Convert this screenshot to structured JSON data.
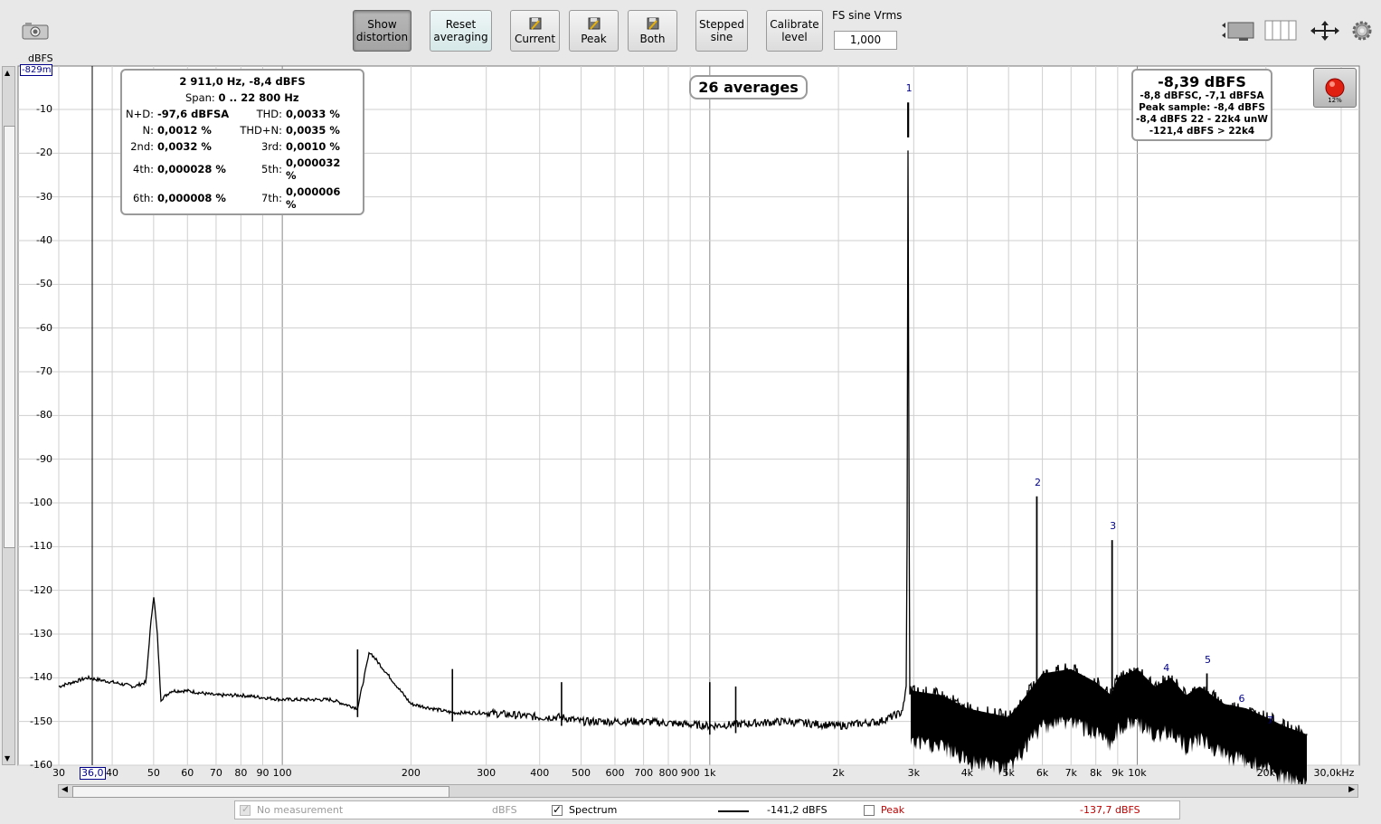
{
  "toolbar": {
    "show_distortion": "Show\ndistortion",
    "reset_averaging": "Reset\naveraging",
    "current": "Current",
    "peak": "Peak",
    "both": "Both",
    "stepped_sine": "Stepped\nsine",
    "calibrate_level": "Calibrate\nlevel",
    "fs_label": "FS sine Vrms",
    "fs_value": "1,000"
  },
  "y_axis": {
    "unit": "dBFS",
    "cursor_value": "-829m",
    "ticks": [
      "-10",
      "-20",
      "-30",
      "-40",
      "-50",
      "-60",
      "-70",
      "-80",
      "-90",
      "-100",
      "-110",
      "-120",
      "-130",
      "-140",
      "-150",
      "-160"
    ]
  },
  "x_axis": {
    "cursor_value": "36,0",
    "ticks": [
      "30",
      "40",
      "50",
      "60",
      "70",
      "80",
      "90",
      "100",
      "200",
      "300",
      "400",
      "500",
      "600",
      "700",
      "800",
      "900",
      "1k",
      "2k",
      "3k",
      "4k",
      "5k",
      "6k",
      "7k",
      "8k",
      "9k",
      "10k",
      "20k",
      "30,0kHz"
    ]
  },
  "distortion_panel": {
    "headline": "2 911,0 Hz, -8,4 dBFS",
    "span_label": "Span:",
    "span_value": "0 .. 22 800 Hz",
    "nd_label": "N+D:",
    "nd_value": "-97,6 dBFSA",
    "thd_label": "THD:",
    "thd_value": "0,0033 %",
    "n_label": "N:",
    "n_value": "0,0012 %",
    "thdn_label": "THD+N:",
    "thdn_value": "0,0035 %",
    "h2_label": "2nd:",
    "h2_value": "0,0032 %",
    "h3_label": "3rd:",
    "h3_value": "0,0010 %",
    "h4_label": "4th:",
    "h4_value": "0,000028 %",
    "h5_label": "5th:",
    "h5_value": "0,000032\n%",
    "h6_label": "6th:",
    "h6_value": "0,000008 %",
    "h7_label": "7th:",
    "h7_value": "0,000006\n%"
  },
  "averages_label": "26 averages",
  "level_panel": {
    "main": "-8,39 dBFS",
    "line1": "-8,8 dBFSC, -7,1 dBFSA",
    "line2": "Peak sample: -8,4 dBFS",
    "line3": "-8,4 dBFS 22 - 22k4 unW",
    "line4": "-121,4 dBFS > 22k4"
  },
  "record_percent": "12%",
  "harmonic_labels": [
    "1",
    "2",
    "3",
    "4",
    "5",
    "6",
    "7"
  ],
  "legend": {
    "no_measurement": "No measurement",
    "no_measurement_unit": "dBFS",
    "spectrum": "Spectrum",
    "spectrum_value": "-141,2 dBFS",
    "peak": "Peak",
    "peak_value": "-137,7 dBFS",
    "spectrum_color": "#000000",
    "peak_color": "#c00000"
  },
  "chart_data": {
    "type": "line",
    "xscale": "log",
    "xlim": [
      30,
      30000
    ],
    "ylim": [
      -160,
      -8
    ],
    "ylabel": "dBFS",
    "series": [
      {
        "name": "Spectrum",
        "color": "#000000",
        "x": [
          30,
          35,
          40,
          45,
          48,
          49,
          50,
          51,
          52,
          55,
          60,
          70,
          80,
          100,
          130,
          150,
          160,
          200,
          250,
          300,
          400,
          450,
          500,
          700,
          1000,
          1500,
          2000,
          2500,
          2800,
          2850,
          2890,
          2905,
          2911,
          2917,
          2930,
          3000,
          3500,
          4000,
          5000,
          5500,
          6000,
          7000,
          8000,
          8700,
          9000,
          10000,
          11000,
          12000,
          13000,
          14000,
          16000,
          18000,
          20000,
          22000,
          25000
        ],
        "y": [
          -142,
          -140,
          -141,
          -142,
          -141,
          -130,
          -121,
          -130,
          -145,
          -143,
          -143,
          -144,
          -144,
          -145,
          -145,
          -147,
          -134,
          -146,
          -148,
          -148,
          -149,
          -149,
          -150,
          -150,
          -151,
          -150,
          -151,
          -150,
          -148,
          -146,
          -140,
          -40,
          -8.4,
          -40,
          -143,
          -144,
          -145,
          -148,
          -150,
          -145,
          -140,
          -139,
          -142,
          -145,
          -141,
          -139,
          -143,
          -141,
          -145,
          -143,
          -147,
          -148,
          -150,
          -152,
          -154
        ]
      },
      {
        "name": "Harmonics",
        "points": [
          {
            "label": "1",
            "x": 2911,
            "y": -8.4
          },
          {
            "label": "2",
            "x": 5822,
            "y": -98.5
          },
          {
            "label": "3",
            "x": 8733,
            "y": -108.5
          },
          {
            "label": "4",
            "x": 11644,
            "y": -141
          },
          {
            "label": "5",
            "x": 14555,
            "y": -139
          },
          {
            "label": "6",
            "x": 17466,
            "y": -148
          },
          {
            "label": "7",
            "x": 20377,
            "y": -153
          }
        ]
      }
    ]
  }
}
